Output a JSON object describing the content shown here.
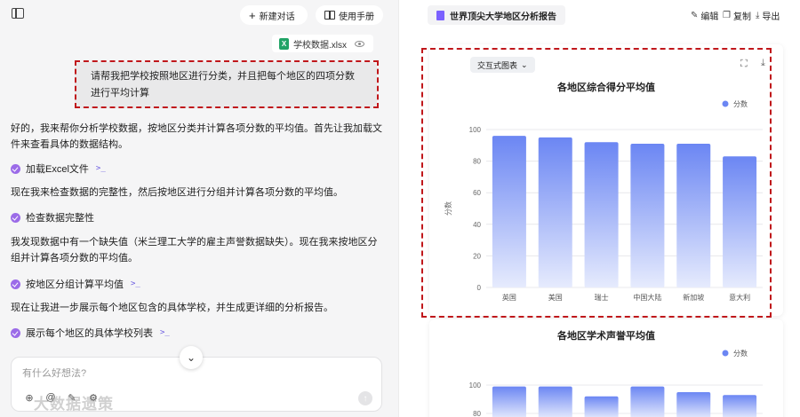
{
  "left": {
    "new_chat": "新建对话",
    "manual": "使用手册",
    "attachment": "学校数据.xlsx",
    "user_message": "请帮我把学校按照地区进行分类，并且把每个地区的四项分数进行平均计算",
    "messages": [
      "好的，我来帮你分析学校数据，按地区分类并计算各项分数的平均值。首先让我加载文件来查看具体的数据结构。",
      "现在我来检查数据的完整性，然后按地区进行分组并计算各项分数的平均值。",
      "我发现数据中有一个缺失值（米兰理工大学的雇主声誉数据缺失）。现在我来按地区分组并计算各项分数的平均值。",
      "现在让我进一步展示每个地区包含的具体学校，并生成更详细的分析报告。"
    ],
    "steps": [
      "加载Excel文件",
      "检查数据完整性",
      "按地区分组计算平均值",
      "展示每个地区的具体学校列表"
    ],
    "input_placeholder": "有什么好想法?",
    "watermark": "大数据遗策"
  },
  "right": {
    "doc_title": "世界顶尖大学地区分析报告",
    "edit": "编辑",
    "copy": "复制",
    "export": "导出",
    "dropdown": "交互式图表"
  },
  "icons": {
    "sidebar": "sidebar-toggle-icon",
    "plus": "plus-icon",
    "book": "book-icon",
    "excel": "excel-file-icon",
    "eye": "eye-icon",
    "check": "check-circle-icon",
    "terminal": "terminal-icon",
    "scroll": "chevron-down-icon",
    "document": "document-icon",
    "expand": "expand-icon",
    "download": "download-icon"
  },
  "colors": {
    "bar_top": "#6b86f3",
    "bar_bottom": "#e6ebfd",
    "check": "#9b6be8",
    "annotation": "#c0171b"
  },
  "chart_data": [
    {
      "type": "bar",
      "title": "各地区综合得分平均值",
      "ylabel": "分数",
      "legend": "分数",
      "legend_position": "top-right",
      "categories": [
        "英国",
        "美国",
        "瑞士",
        "中国大陆",
        "新加坡",
        "意大利"
      ],
      "values": [
        96,
        95,
        92,
        91,
        91,
        83
      ],
      "ylim": [
        0,
        100
      ],
      "yticks": [
        0,
        20,
        40,
        60,
        80,
        100
      ],
      "grid": true
    },
    {
      "type": "bar",
      "title": "各地区学术声誉平均值",
      "legend": "分数",
      "legend_position": "top-right",
      "yticks_visible": [
        80,
        100
      ],
      "values": [
        99,
        99,
        92,
        99,
        95,
        93
      ]
    }
  ]
}
